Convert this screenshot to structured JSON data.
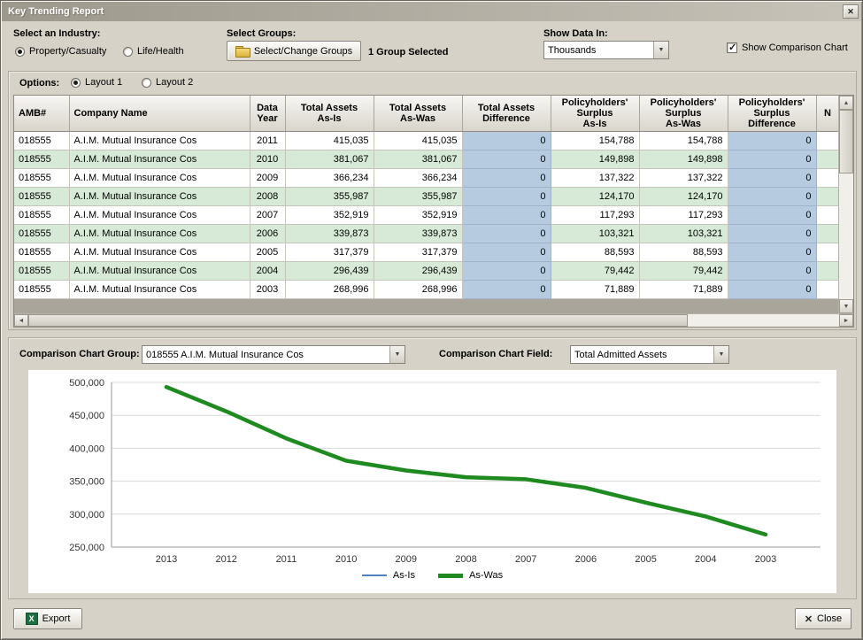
{
  "window": {
    "title": "Key Trending Report",
    "close_glyph": "✕"
  },
  "controls": {
    "industry": {
      "label": "Select an Industry:",
      "options": [
        {
          "label": "Property/Casualty",
          "selected": true
        },
        {
          "label": "Life/Health",
          "selected": false
        }
      ]
    },
    "groups": {
      "label": "Select Groups:",
      "button_label": "Select/Change Groups",
      "status": "1 Group Selected"
    },
    "show_data_in": {
      "label": "Show Data In:",
      "value": "Thousands"
    },
    "comparison_chart_checkbox": {
      "label": "Show Comparison Chart",
      "checked": true
    }
  },
  "options_bar": {
    "label": "Options:",
    "layouts": [
      {
        "label": "Layout 1",
        "selected": true
      },
      {
        "label": "Layout 2",
        "selected": false
      }
    ]
  },
  "table": {
    "columns": [
      "AMB#",
      "Company Name",
      "Data\nYear",
      "Total Assets\nAs-Is",
      "Total Assets\nAs-Was",
      "Total Assets\nDifference",
      "Policyholders'\nSurplus\nAs-Is",
      "Policyholders'\nSurplus\nAs-Was",
      "Policyholders'\nSurplus\nDifference",
      "N"
    ],
    "diff_columns": [
      5,
      8
    ],
    "rows": [
      [
        "018555",
        "A.I.M. Mutual Insurance Cos",
        "2011",
        "415,035",
        "415,035",
        "0",
        "154,788",
        "154,788",
        "0",
        ""
      ],
      [
        "018555",
        "A.I.M. Mutual Insurance Cos",
        "2010",
        "381,067",
        "381,067",
        "0",
        "149,898",
        "149,898",
        "0",
        ""
      ],
      [
        "018555",
        "A.I.M. Mutual Insurance Cos",
        "2009",
        "366,234",
        "366,234",
        "0",
        "137,322",
        "137,322",
        "0",
        ""
      ],
      [
        "018555",
        "A.I.M. Mutual Insurance Cos",
        "2008",
        "355,987",
        "355,987",
        "0",
        "124,170",
        "124,170",
        "0",
        ""
      ],
      [
        "018555",
        "A.I.M. Mutual Insurance Cos",
        "2007",
        "352,919",
        "352,919",
        "0",
        "117,293",
        "117,293",
        "0",
        ""
      ],
      [
        "018555",
        "A.I.M. Mutual Insurance Cos",
        "2006",
        "339,873",
        "339,873",
        "0",
        "103,321",
        "103,321",
        "0",
        ""
      ],
      [
        "018555",
        "A.I.M. Mutual Insurance Cos",
        "2005",
        "317,379",
        "317,379",
        "0",
        "88,593",
        "88,593",
        "0",
        ""
      ],
      [
        "018555",
        "A.I.M. Mutual Insurance Cos",
        "2004",
        "296,439",
        "296,439",
        "0",
        "79,442",
        "79,442",
        "0",
        ""
      ],
      [
        "018555",
        "A.I.M. Mutual Insurance Cos",
        "2003",
        "268,996",
        "268,996",
        "0",
        "71,889",
        "71,889",
        "0",
        ""
      ]
    ]
  },
  "chart_controls": {
    "group_label": "Comparison Chart Group:",
    "group_value": "018555  A.I.M. Mutual Insurance Cos",
    "field_label": "Comparison Chart Field:",
    "field_value": "Total Admitted Assets"
  },
  "chart_data": {
    "type": "line",
    "x": [
      "2013",
      "2012",
      "2011",
      "2010",
      "2009",
      "2008",
      "2007",
      "2006",
      "2005",
      "2004",
      "2003"
    ],
    "series": [
      {
        "name": "As-Is",
        "color": "#4f81bd",
        "stroke_width": 2,
        "values": [
          493000,
          456000,
          415035,
          381067,
          366234,
          355987,
          352919,
          339873,
          317379,
          296439,
          268996
        ]
      },
      {
        "name": "As-Was",
        "color": "#1f8a1f",
        "stroke_width": 4.5,
        "values": [
          493000,
          456000,
          415035,
          381067,
          366234,
          355987,
          352919,
          339873,
          317379,
          296439,
          268996
        ]
      }
    ],
    "ylim": [
      250000,
      500000
    ],
    "ytick_step": 50000,
    "grid": true,
    "legend_position": "bottom"
  },
  "footer": {
    "export_label": "Export",
    "close_label": "Close",
    "close_glyph": "✕",
    "excel_icon_text": "X"
  },
  "colors": {
    "row_alt": "#d7ead7",
    "diff_cell": "#b6cbe0",
    "as_is": "#4f81bd",
    "as_was": "#1f8a1f"
  }
}
